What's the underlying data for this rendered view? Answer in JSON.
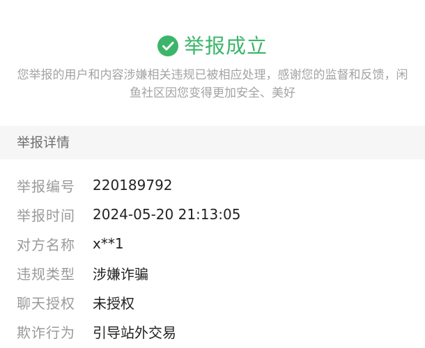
{
  "result": {
    "icon": "check-circle-icon",
    "title": "举报成立",
    "description": "您举报的用户和内容涉嫌相关违规已被相应处理，感谢您的监督和反馈，闲鱼社区因您变得更加安全、美好",
    "accent_color": "#3cb56a"
  },
  "section": {
    "title": "举报详情"
  },
  "details": [
    {
      "label": "举报编号",
      "value": "220189792"
    },
    {
      "label": "举报时间",
      "value": "2024-05-20 21:13:05"
    },
    {
      "label": "对方名称",
      "value": "x**1"
    },
    {
      "label": "违规类型",
      "value": "涉嫌诈骗"
    },
    {
      "label": "聊天授权",
      "value": "未授权"
    },
    {
      "label": "欺诈行为",
      "value": "引导站外交易"
    }
  ]
}
